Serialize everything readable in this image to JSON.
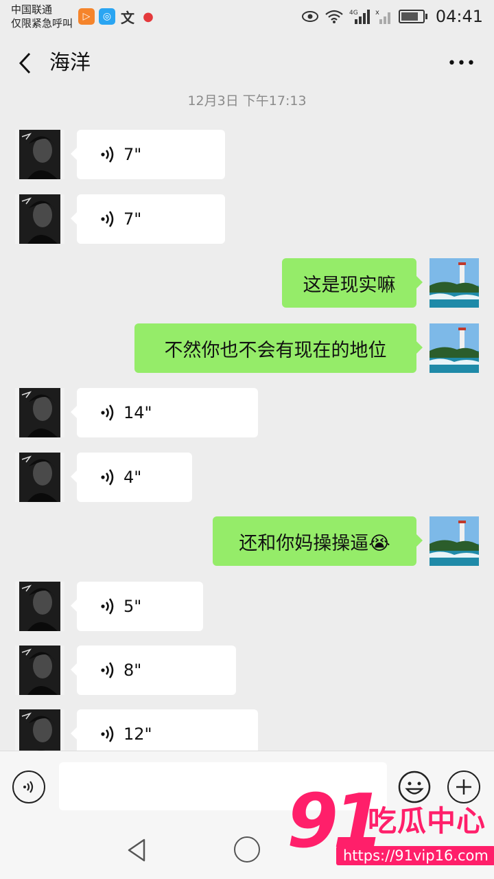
{
  "status_bar": {
    "carrier": "中国联通",
    "carrier_note": "仅限紧急呼叫",
    "network": "4G",
    "time": "04:41"
  },
  "header": {
    "title": "海洋",
    "back_icon": "chevron-left-icon",
    "more_icon": "more-dots-icon",
    "more_label": "•••"
  },
  "timestamp": "12月3日 下午17:13",
  "messages": [
    {
      "side": "in",
      "type": "voice",
      "duration": "7\""
    },
    {
      "side": "in",
      "type": "voice",
      "duration": "7\""
    },
    {
      "side": "out",
      "type": "text",
      "text": "这是现实嘛"
    },
    {
      "side": "out",
      "type": "text",
      "text": "不然你也不会有现在的地位"
    },
    {
      "side": "in",
      "type": "voice",
      "duration": "14\""
    },
    {
      "side": "in",
      "type": "voice",
      "duration": "4\""
    },
    {
      "side": "out",
      "type": "text",
      "text": "还和你妈操操逼😭"
    },
    {
      "side": "in",
      "type": "voice",
      "duration": "5\""
    },
    {
      "side": "in",
      "type": "voice",
      "duration": "8\""
    },
    {
      "side": "in",
      "type": "voice",
      "duration": "12\""
    }
  ],
  "input": {
    "value": "",
    "voice_icon": "voice-toggle-icon",
    "emoji_icon": "emoji-icon",
    "plus_icon": "plus-icon"
  },
  "watermark": {
    "logo": "91",
    "name": "吃瓜中心",
    "url": "https://91vip16.com"
  },
  "colors": {
    "background": "#ededed",
    "bubble_out": "#95ec69",
    "bubble_in": "#ffffff",
    "watermark": "#ff1f6a"
  }
}
